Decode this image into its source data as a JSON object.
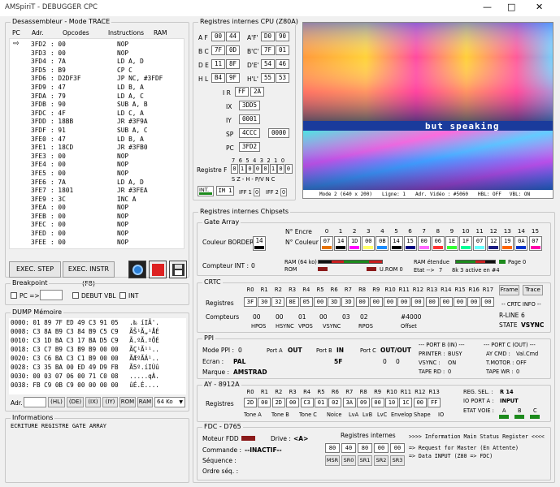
{
  "window": {
    "title": "AMSpiriT - DEBUGGER CPC"
  },
  "disasm": {
    "title": "Desassembleur - Mode TRACE",
    "headers": [
      "PC",
      "Adr.",
      "Opcodes",
      "Instructions",
      "RAM"
    ],
    "rows": [
      [
        "3FD2",
        ": 00",
        "NOP"
      ],
      [
        "3FD3",
        ": 00",
        "NOP"
      ],
      [
        "3FD4",
        ": 7A",
        "LD A, D"
      ],
      [
        "3FD5",
        ": B9",
        "CP C"
      ],
      [
        "3FD6",
        ": D2DF3F",
        "JP NC, #3FDF"
      ],
      [
        "3FD9",
        ": 47",
        "LD B, A"
      ],
      [
        "3FDA",
        ": 79",
        "LD A, C"
      ],
      [
        "3FDB",
        ": 90",
        "SUB A, B"
      ],
      [
        "3FDC",
        ": 4F",
        "LD C, A"
      ],
      [
        "3FDD",
        ": 18BB",
        "JR #3F9A"
      ],
      [
        "3FDF",
        ": 91",
        "SUB A, C"
      ],
      [
        "3FE0",
        ": 47",
        "LD B, A"
      ],
      [
        "3FE1",
        ": 18CD",
        "JR #3FB0"
      ],
      [
        "3FE3",
        ": 00",
        "NOP"
      ],
      [
        "3FE4",
        ": 00",
        "NOP"
      ],
      [
        "3FE5",
        ": 00",
        "NOP"
      ],
      [
        "3FE6",
        ": 7A",
        "LD A, D"
      ],
      [
        "3FE7",
        ": 1801",
        "JR #3FEA"
      ],
      [
        "3FE9",
        ": 3C",
        "INC A"
      ],
      [
        "3FEA",
        ": 00",
        "NOP"
      ],
      [
        "3FEB",
        ": 00",
        "NOP"
      ],
      [
        "3FEC",
        ": 00",
        "NOP"
      ],
      [
        "3FED",
        ": 00",
        "NOP"
      ],
      [
        "3FEE",
        ": 00",
        "NOP"
      ]
    ],
    "step_btn": "EXEC. STEP (F7)",
    "instr_btn": "EXEC. INSTR (F8)"
  },
  "breakpoint": {
    "title": "Breakpoint",
    "pc_label": "PC =>",
    "debut_vbl": "DEBUT VBL",
    "int": "INT"
  },
  "dump": {
    "title": "DUMP Mémoire",
    "rows": [
      "0000: 01 89 7F ED 49 C3 91 05   .‰ íIÃ'.",
      "0008: C3 8A B9 C3 84 B9 C5 C9   ÃŠ¹Ã„¹ÅÉ",
      "0010: C3 1D BA C3 17 BA D5 C9   Ã.ºÃ.ºÕÉ",
      "0018: C3 C7 B9 C3 B9 B9 00 00   ÃÇ¹Ã¹¹..",
      "0020: C3 C6 BA C3 C1 B9 00 00   ÃÆºÃÁ¹..",
      "0028: C3 35 BA 00 ED 49 D9 FB   Ã5º.íIÙû",
      "0030: 00 03 07 06 00 71 C0 08   .....qÀ.",
      "0038: FB C9 0B C9 00 00 00 00   ûÉ.É...."
    ],
    "adr_label": "Adr.",
    "btns": [
      "(HL)",
      "(DE)",
      "(IX)",
      "(IY)",
      "ROM",
      "RAM"
    ],
    "ram_select": "64 Ko"
  },
  "info": {
    "title": "Informations",
    "text": "ECRITURE REGISTRE GATE ARRAY"
  },
  "cpu": {
    "title": "Registres internes CPU (Z80A)",
    "AF": [
      "00",
      "44"
    ],
    "AF2": [
      "D0",
      "90"
    ],
    "BC": [
      "7F",
      "0D"
    ],
    "BC2": [
      "7F",
      "01"
    ],
    "DE": [
      "11",
      "8F"
    ],
    "DE2": [
      "54",
      "46"
    ],
    "HL": [
      "B4",
      "9F"
    ],
    "HL2": [
      "55",
      "53"
    ],
    "IR": [
      "FF",
      "2A"
    ],
    "IX": "3DD5",
    "IY": "0001",
    "SP": "4CCC",
    "SP2": "0000",
    "PC": "3FD2",
    "flag_label": "Registre F",
    "flag_bits": [
      "0",
      "1",
      "0",
      "0",
      "0",
      "1",
      "0",
      "0"
    ],
    "flag_nums": "7 6 5 4 3 2 1 0",
    "flag_names": "S  Z  -  H  -  P/V N  C",
    "int": "INT.",
    "im": "IM 1",
    "iff1": "IFF 1",
    "iff2": "IFF 2"
  },
  "screen": {
    "status": [
      "Mode 2 (640 x 200)",
      "Ligne: 1",
      "Adr. Vidéo : #5060",
      "HBL: OFF",
      "VBL: ON"
    ],
    "banner": "but speaking"
  },
  "chipsets": {
    "title": "Registres internes Chipsets",
    "ga": {
      "title": "Gate Array",
      "encre_label": "N° Encre",
      "couleur_label": "N° Couleur",
      "border_label": "Couleur BORDER",
      "border_val": "14",
      "encres": [
        "0",
        "1",
        "2",
        "3",
        "4",
        "5",
        "6",
        "7",
        "8",
        "9",
        "10",
        "11",
        "12",
        "13",
        "14",
        "15"
      ],
      "couleurs": [
        "07",
        "14",
        "1D",
        "00",
        "0B",
        "14",
        "15",
        "00",
        "06",
        "1E",
        "1F",
        "07",
        "12",
        "19",
        "0A",
        "07"
      ],
      "compteur_label": "Compteur INT :",
      "compteur_val": "0",
      "ram_label": "RAM (64 ko)",
      "rom_label": "ROM",
      "urom_label": "U.ROM 0",
      "ram_ext_label": "RAM étendue",
      "etat": "Etat -->",
      "etat_val": "7",
      "etat_desc": "8k 3 active en #4",
      "page_label": "Page 0"
    },
    "crtc": {
      "title": "CRTC",
      "headers": [
        "R0",
        "R1",
        "R2",
        "R3",
        "R4",
        "R5",
        "R6",
        "R7",
        "R8",
        "R9",
        "R10",
        "R11",
        "R12",
        "R13",
        "R14",
        "R15",
        "R16",
        "R17"
      ],
      "regs": [
        "3F",
        "30",
        "32",
        "8E",
        "05",
        "00",
        "3D",
        "3D",
        "00",
        "00",
        "00",
        "00",
        "00",
        "00",
        "00",
        "00",
        "00",
        "00"
      ],
      "registres_label": "Registres",
      "compteurs_label": "Compteurs",
      "frame": "Frame",
      "trace": "Trace",
      "info": "-- CRTC INFO --",
      "cnt": [
        {
          "v": "00",
          "l": "HPOS"
        },
        {
          "v": "00",
          "l": "HSYNC"
        },
        {
          "v": "01",
          "l": "VPOS"
        },
        {
          "v": "00",
          "l": "VSYNC"
        },
        {
          "v": "03",
          "l": ""
        },
        {
          "v": "02",
          "l": "RPOS"
        },
        {
          "v": "#4000",
          "l": "Offset"
        }
      ],
      "rline_label": "R-LINE",
      "rline": "6",
      "state_label": "STATE",
      "state": "VSYNC"
    },
    "ppi": {
      "title": "PPI",
      "mode_label": "Mode PPI :",
      "mode": "0",
      "ecran_label": "Ecran :",
      "ecran": "PAL",
      "marque_label": "Marque :",
      "marque": "AMSTRAD",
      "porta_label": "Port A",
      "porta": "OUT",
      "portb_label": "Port B",
      "portb": "IN",
      "portb_val": "5F",
      "portc_label": "Port C",
      "portc": "OUT/OUT",
      "portc_v1": "0",
      "portc_v2": "0",
      "portb_in": "--- PORT B (IN) ---",
      "printer_label": "PRINTER :",
      "printer": "BUSY",
      "vsync_label": "VSYNC :",
      "vsync": "ON",
      "tape_rd_label": "TAPE RD :",
      "tape_rd": "0",
      "portc_out": "--- PORT C (OUT) ---",
      "ay_cmd_label": "AY CMD :",
      "ay_cmd": "Val.Cmd",
      "tmotor_label": "T.MOTOR :",
      "tmotor": "OFF",
      "tape_wr_label": "TAPE WR :",
      "tape_wr": "0"
    },
    "ay": {
      "title": "AY - 8912A",
      "headers": [
        "R0",
        "R1",
        "R2",
        "R3",
        "R4",
        "R5",
        "R6",
        "R7",
        "R8",
        "R9",
        "R10",
        "R11",
        "R12",
        "R13"
      ],
      "regs": [
        "2D",
        "00",
        "2D",
        "00",
        "C3",
        "01",
        "02",
        "3A",
        "09",
        "00",
        "10",
        "1C",
        "00",
        "FF"
      ],
      "names": [
        "Tone A",
        "Tone B",
        "Tone C",
        "Noice",
        "LvA",
        "LvB",
        "LvC",
        "Envelop",
        "Shape",
        "IO"
      ],
      "registres_label": "Registres",
      "regsel_label": "REG. SEL. :",
      "regsel": "R 14",
      "ioport_label": "IO PORT A :",
      "ioport": "INPUT",
      "etat_label": "ETAT VOIE :",
      "voies": [
        "A",
        "B",
        "C"
      ]
    },
    "fdc": {
      "title": "FDC - D765",
      "moteur_label": "Moteur FDD :",
      "drive_label": "Drive :",
      "drive": "<A>",
      "commande_label": "Commande :",
      "commande": "--INACTIF--",
      "sequence_label": "Séquence :",
      "ordre_label": "Ordre séq. :",
      "regs_label": "Registres internes",
      "regs": [
        "80",
        "40",
        "80",
        "00",
        "00"
      ],
      "reg_names": [
        "MSR",
        "SR0",
        "SR1",
        "SR2",
        "SR3"
      ],
      "status": [
        ">>>> Information Main Status Register <<<<",
        "=> Request for Master (En Attente)",
        "=> Data INPUT (Z80 => FDC)"
      ]
    }
  },
  "colors": {
    "accent_green": "#1c8a1c",
    "accent_red": "#c81e1e",
    "navy": "#1a2a6e"
  }
}
